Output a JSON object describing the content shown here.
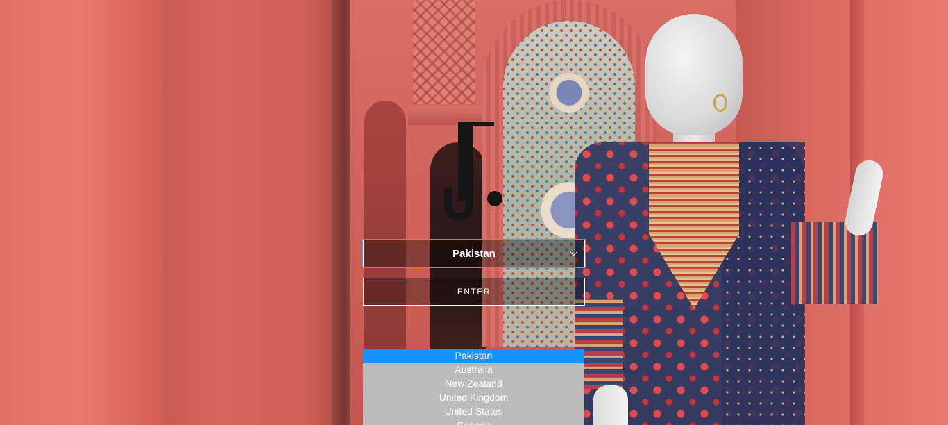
{
  "country_selector": {
    "selected": "Pakistan",
    "chevron_icon": "chevron-down-icon"
  },
  "enter_button": {
    "label": "ENTER"
  },
  "dropdown": {
    "options": [
      {
        "label": "Pakistan",
        "selected": true
      },
      {
        "label": "Australia",
        "selected": false
      },
      {
        "label": "New Zealand",
        "selected": false
      },
      {
        "label": "United Kingdom",
        "selected": false
      },
      {
        "label": "United States",
        "selected": false
      },
      {
        "label": "Canada",
        "selected": false
      }
    ],
    "highlight_color": "#1593ff",
    "list_background": "#bcbcbc"
  },
  "brand": {
    "logo": "J.",
    "logo_color": "#151515"
  }
}
